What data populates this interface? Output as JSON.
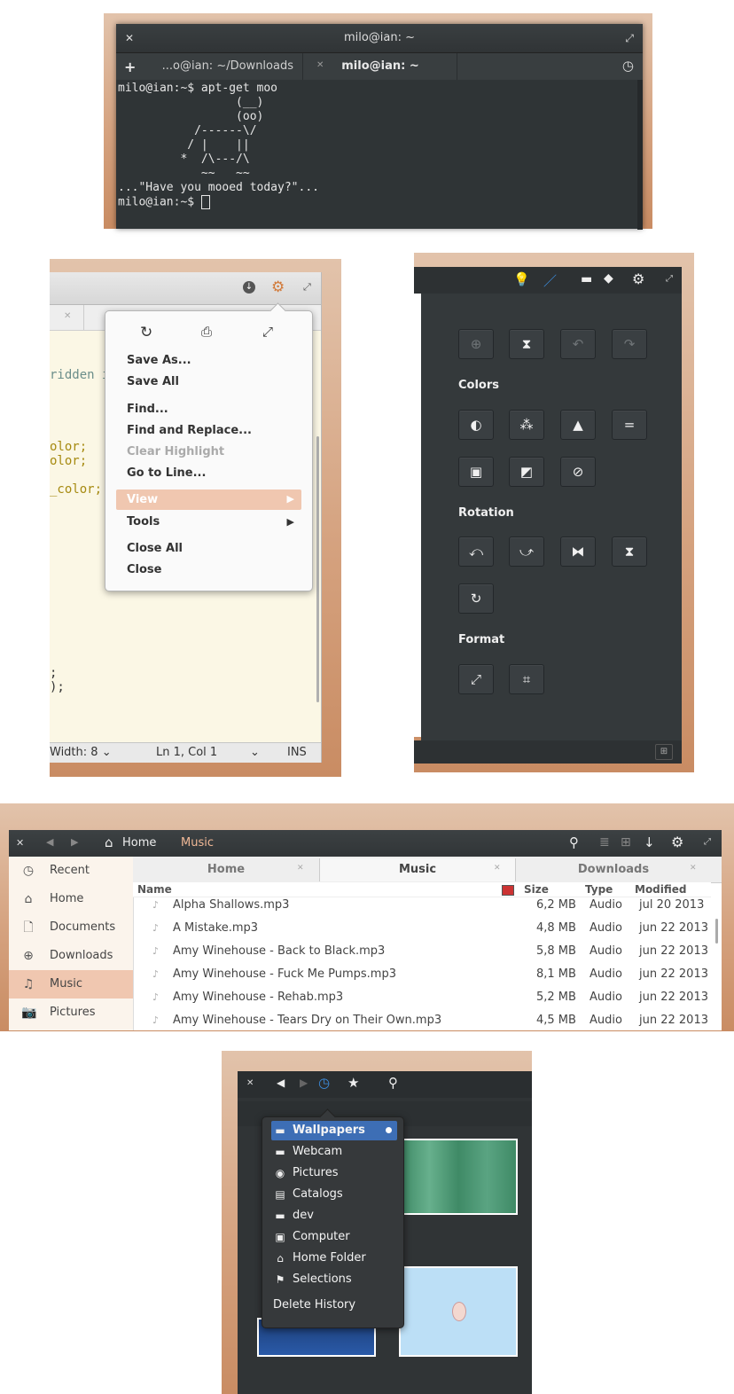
{
  "terminal": {
    "window_title": "milo@ian: ~",
    "tabs": [
      {
        "label": "...o@ian: ~/Downloads"
      },
      {
        "label": "milo@ian: ~"
      }
    ],
    "new_tab_label": "+",
    "output": "milo@ian:~$ apt-get moo\n                 (__)\n                 (oo)\n           /------\\/\n          / |    ||\n         *  /\\---/\\\n            ~~   ~~\n...\"Have you mooed today?\"...",
    "prompt": "milo@ian:~$ "
  },
  "editor": {
    "code_lines": [
      "ridden i",
      "olor;",
      "olor;",
      "_color;",
      ";",
      ");"
    ],
    "status": {
      "width": "Width: 8",
      "position": "Ln 1, Col 1",
      "mode": "INS"
    },
    "menu": {
      "items": [
        {
          "label": "Save As...",
          "enabled": true
        },
        {
          "label": "Save All",
          "enabled": true
        },
        {
          "label": "Find...",
          "enabled": true
        },
        {
          "label": "Find and Replace...",
          "enabled": true
        },
        {
          "label": "Clear Highlight",
          "enabled": false
        },
        {
          "label": "Go to Line...",
          "enabled": true
        },
        {
          "label": "View",
          "enabled": true,
          "highlighted": true,
          "submenu": true
        },
        {
          "label": "Tools",
          "enabled": true,
          "submenu": true
        },
        {
          "label": "Close All",
          "enabled": true
        },
        {
          "label": "Close",
          "enabled": true
        }
      ]
    }
  },
  "photo_tools": {
    "sections": {
      "colors": "Colors",
      "rotation": "Rotation",
      "format": "Format"
    }
  },
  "file_manager": {
    "breadcrumb": {
      "home": "Home",
      "current": "Music"
    },
    "sidebar": [
      {
        "label": "Recent",
        "icon": "clock-icon"
      },
      {
        "label": "Home",
        "icon": "home-icon"
      },
      {
        "label": "Documents",
        "icon": "document-icon"
      },
      {
        "label": "Downloads",
        "icon": "download-icon"
      },
      {
        "label": "Music",
        "icon": "music-icon",
        "selected": true
      },
      {
        "label": "Pictures",
        "icon": "camera-icon"
      }
    ],
    "tabs": [
      {
        "label": "Home"
      },
      {
        "label": "Music"
      },
      {
        "label": "Downloads"
      }
    ],
    "columns": {
      "name": "Name",
      "size": "Size",
      "type": "Type",
      "modified": "Modified"
    },
    "rows": [
      {
        "name": "Alpha Shallows.mp3",
        "size": "6,2 MB",
        "type": "Audio",
        "modified": "jul 20 2013"
      },
      {
        "name": "A Mistake.mp3",
        "size": "4,8 MB",
        "type": "Audio",
        "modified": "jun 22 2013"
      },
      {
        "name": "Amy Winehouse - Back to Black.mp3",
        "size": "5,8 MB",
        "type": "Audio",
        "modified": "jun 22 2013"
      },
      {
        "name": "Amy Winehouse - Fuck Me Pumps.mp3",
        "size": "8,1 MB",
        "type": "Audio",
        "modified": "jun 22 2013"
      },
      {
        "name": "Amy Winehouse - Rehab.mp3",
        "size": "5,2 MB",
        "type": "Audio",
        "modified": "jun 22 2013"
      },
      {
        "name": "Amy Winehouse - Tears Dry on Their Own.mp3",
        "size": "4,5 MB",
        "type": "Audio",
        "modified": "jun 22 2013"
      }
    ]
  },
  "image_viewer": {
    "history": [
      {
        "label": "Wallpapers",
        "icon": "folder-icon",
        "selected": true
      },
      {
        "label": "Webcam",
        "icon": "folder-icon"
      },
      {
        "label": "Pictures",
        "icon": "camera-icon"
      },
      {
        "label": "Catalogs",
        "icon": "catalog-icon"
      },
      {
        "label": "dev",
        "icon": "folder-icon"
      },
      {
        "label": "Computer",
        "icon": "computer-icon"
      },
      {
        "label": "Home Folder",
        "icon": "home-icon"
      },
      {
        "label": "Selections",
        "icon": "flag-icon"
      }
    ],
    "delete_history": "Delete History"
  },
  "colors": {
    "accent": "#f0c7b0",
    "selection_blue": "#3d6eb5",
    "terminal_bg": "#2f3436"
  }
}
